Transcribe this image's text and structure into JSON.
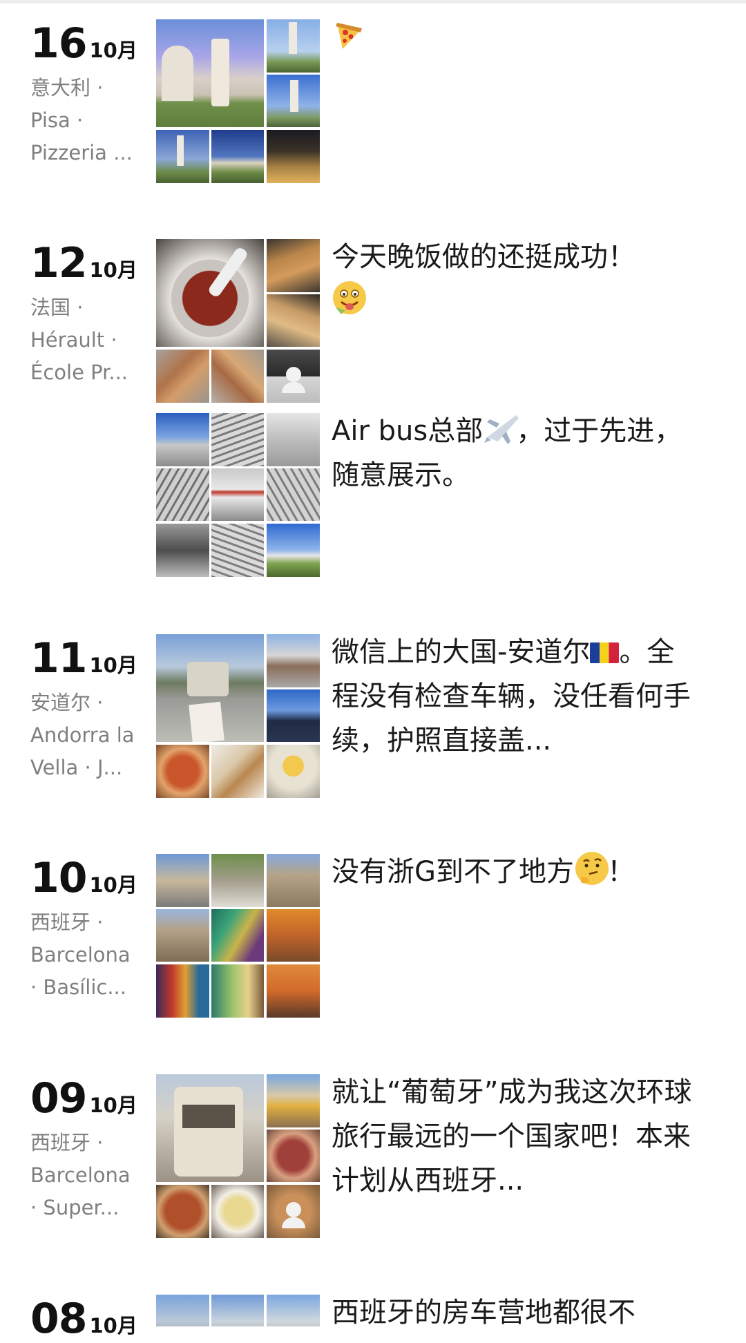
{
  "feed": {
    "posts": [
      {
        "day": "16",
        "month": "10月",
        "location_lines": [
          "意大利 ·",
          "Pisa ·",
          "Pizzeria ..."
        ],
        "entries": [
          {
            "caption": "",
            "emoji": "pizza-icon",
            "photo_count": 6
          }
        ]
      },
      {
        "day": "12",
        "month": "10月",
        "location_lines": [
          "法国 ·",
          "Hérault ·",
          "École Pr..."
        ],
        "entries": [
          {
            "caption": "今天晚饭做的还挺成功！",
            "emoji": "yum-face-icon",
            "photo_count": 7
          },
          {
            "caption_before_emoji": "Air bus总部",
            "emoji": "airplane-icon",
            "caption_after_emoji": "，过于先进，随意展示。",
            "photo_count": 9
          }
        ]
      },
      {
        "day": "11",
        "month": "10月",
        "location_lines": [
          "安道尔 ·",
          "Andorra la",
          "Vella · J..."
        ],
        "entries": [
          {
            "caption_before_emoji": "微信上的大国-安道尔",
            "emoji": "andorra-flag-icon",
            "caption_after_emoji": "。全程没有检查车辆，没任看何手续，护照直接盖...",
            "photo_count": 6
          }
        ]
      },
      {
        "day": "10",
        "month": "10月",
        "location_lines": [
          "西班牙 ·",
          "Barcelona",
          "· Basílic..."
        ],
        "entries": [
          {
            "caption_before_emoji": "没有浙G到不了地方",
            "emoji": "thinking-face-icon",
            "caption_after_emoji": "！",
            "photo_count": 9
          }
        ]
      },
      {
        "day": "09",
        "month": "10月",
        "location_lines": [
          "西班牙 ·",
          "Barcelona",
          "· Super..."
        ],
        "entries": [
          {
            "caption": "就让“葡萄牙”成为我这次环球旅行最远的一个国家吧！本来计划从西班牙...",
            "photo_count": 6
          }
        ]
      },
      {
        "day": "08",
        "month": "10月",
        "location_lines": [],
        "entries": [
          {
            "caption": "西班牙的房车营地都很不",
            "photo_count": 3
          }
        ]
      }
    ]
  }
}
